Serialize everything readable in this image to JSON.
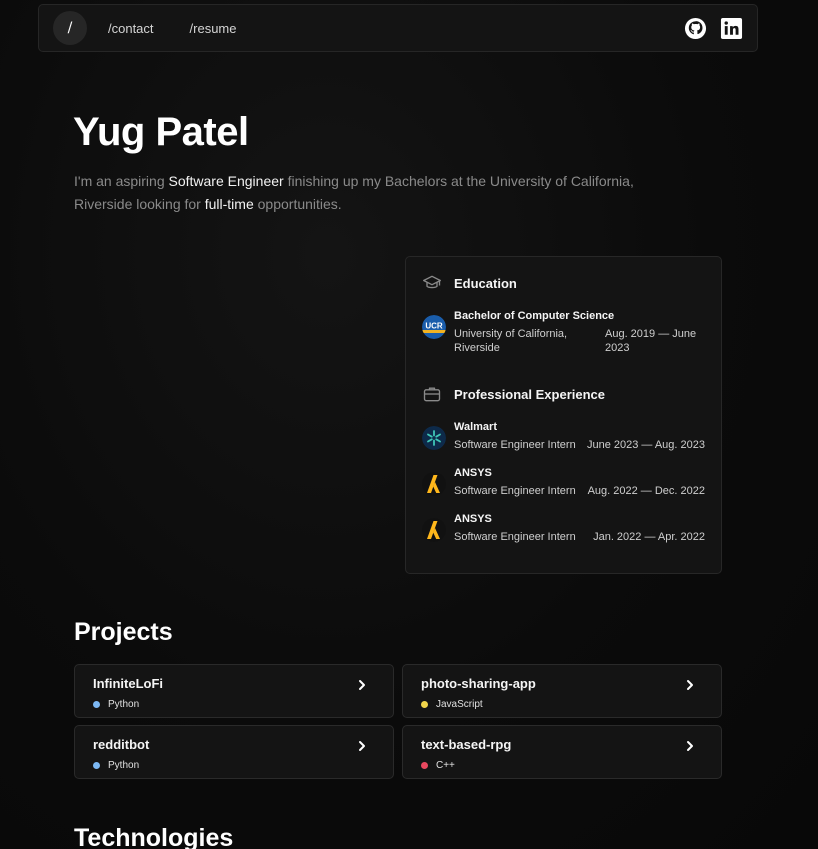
{
  "nav": {
    "home_label": "/",
    "links": [
      "/contact",
      "/resume"
    ],
    "icons": [
      "github-icon",
      "linkedin-icon"
    ]
  },
  "hero": {
    "name": "Yug Patel",
    "bio_parts": [
      "I'm an aspiring ",
      "Software Engineer",
      " finishing up my Bachelors at the University of California, Riverside looking for ",
      "full-time",
      " opportunities."
    ]
  },
  "education": {
    "title": "Education",
    "entries": [
      {
        "org": "Bachelor of Computer Science",
        "role": "University of California, Riverside",
        "dates": "Aug. 2019 — June 2023",
        "logo": "UCR"
      }
    ]
  },
  "experience": {
    "title": "Professional Experience",
    "entries": [
      {
        "org": "Walmart",
        "role": "Software Engineer Intern",
        "dates": "June 2023 — Aug. 2023"
      },
      {
        "org": "ANSYS",
        "role": "Software Engineer Intern",
        "dates": "Aug. 2022 — Dec. 2022"
      },
      {
        "org": "ANSYS",
        "role": "Software Engineer Intern",
        "dates": "Jan. 2022 — Apr. 2022"
      }
    ]
  },
  "projects": {
    "title": "Projects",
    "items": [
      {
        "name": "InfiniteLoFi",
        "lang": "Python",
        "color": "#7cb8f4"
      },
      {
        "name": "photo-sharing-app",
        "lang": "JavaScript",
        "color": "#f1d54b"
      },
      {
        "name": "redditbot",
        "lang": "Python",
        "color": "#7cb8f4"
      },
      {
        "name": "text-based-rpg",
        "lang": "C++",
        "color": "#e8485f"
      }
    ]
  },
  "technologies": {
    "title": "Technologies"
  }
}
